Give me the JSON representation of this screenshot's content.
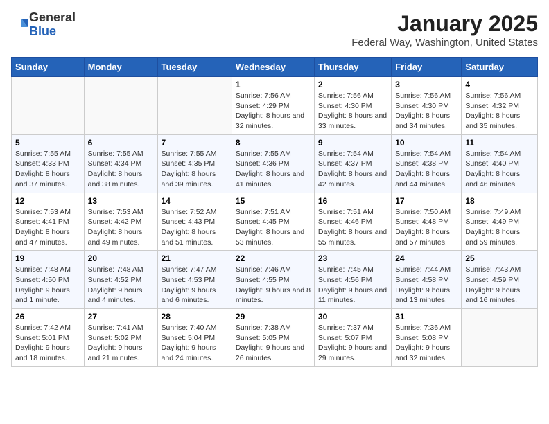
{
  "header": {
    "logo_general": "General",
    "logo_blue": "Blue",
    "title": "January 2025",
    "subtitle": "Federal Way, Washington, United States"
  },
  "days_of_week": [
    "Sunday",
    "Monday",
    "Tuesday",
    "Wednesday",
    "Thursday",
    "Friday",
    "Saturday"
  ],
  "weeks": [
    [
      {
        "num": "",
        "info": ""
      },
      {
        "num": "",
        "info": ""
      },
      {
        "num": "",
        "info": ""
      },
      {
        "num": "1",
        "info": "Sunrise: 7:56 AM\nSunset: 4:29 PM\nDaylight: 8 hours and 32 minutes."
      },
      {
        "num": "2",
        "info": "Sunrise: 7:56 AM\nSunset: 4:30 PM\nDaylight: 8 hours and 33 minutes."
      },
      {
        "num": "3",
        "info": "Sunrise: 7:56 AM\nSunset: 4:30 PM\nDaylight: 8 hours and 34 minutes."
      },
      {
        "num": "4",
        "info": "Sunrise: 7:56 AM\nSunset: 4:32 PM\nDaylight: 8 hours and 35 minutes."
      }
    ],
    [
      {
        "num": "5",
        "info": "Sunrise: 7:55 AM\nSunset: 4:33 PM\nDaylight: 8 hours and 37 minutes."
      },
      {
        "num": "6",
        "info": "Sunrise: 7:55 AM\nSunset: 4:34 PM\nDaylight: 8 hours and 38 minutes."
      },
      {
        "num": "7",
        "info": "Sunrise: 7:55 AM\nSunset: 4:35 PM\nDaylight: 8 hours and 39 minutes."
      },
      {
        "num": "8",
        "info": "Sunrise: 7:55 AM\nSunset: 4:36 PM\nDaylight: 8 hours and 41 minutes."
      },
      {
        "num": "9",
        "info": "Sunrise: 7:54 AM\nSunset: 4:37 PM\nDaylight: 8 hours and 42 minutes."
      },
      {
        "num": "10",
        "info": "Sunrise: 7:54 AM\nSunset: 4:38 PM\nDaylight: 8 hours and 44 minutes."
      },
      {
        "num": "11",
        "info": "Sunrise: 7:54 AM\nSunset: 4:40 PM\nDaylight: 8 hours and 46 minutes."
      }
    ],
    [
      {
        "num": "12",
        "info": "Sunrise: 7:53 AM\nSunset: 4:41 PM\nDaylight: 8 hours and 47 minutes."
      },
      {
        "num": "13",
        "info": "Sunrise: 7:53 AM\nSunset: 4:42 PM\nDaylight: 8 hours and 49 minutes."
      },
      {
        "num": "14",
        "info": "Sunrise: 7:52 AM\nSunset: 4:43 PM\nDaylight: 8 hours and 51 minutes."
      },
      {
        "num": "15",
        "info": "Sunrise: 7:51 AM\nSunset: 4:45 PM\nDaylight: 8 hours and 53 minutes."
      },
      {
        "num": "16",
        "info": "Sunrise: 7:51 AM\nSunset: 4:46 PM\nDaylight: 8 hours and 55 minutes."
      },
      {
        "num": "17",
        "info": "Sunrise: 7:50 AM\nSunset: 4:48 PM\nDaylight: 8 hours and 57 minutes."
      },
      {
        "num": "18",
        "info": "Sunrise: 7:49 AM\nSunset: 4:49 PM\nDaylight: 8 hours and 59 minutes."
      }
    ],
    [
      {
        "num": "19",
        "info": "Sunrise: 7:48 AM\nSunset: 4:50 PM\nDaylight: 9 hours and 1 minute."
      },
      {
        "num": "20",
        "info": "Sunrise: 7:48 AM\nSunset: 4:52 PM\nDaylight: 9 hours and 4 minutes."
      },
      {
        "num": "21",
        "info": "Sunrise: 7:47 AM\nSunset: 4:53 PM\nDaylight: 9 hours and 6 minutes."
      },
      {
        "num": "22",
        "info": "Sunrise: 7:46 AM\nSunset: 4:55 PM\nDaylight: 9 hours and 8 minutes."
      },
      {
        "num": "23",
        "info": "Sunrise: 7:45 AM\nSunset: 4:56 PM\nDaylight: 9 hours and 11 minutes."
      },
      {
        "num": "24",
        "info": "Sunrise: 7:44 AM\nSunset: 4:58 PM\nDaylight: 9 hours and 13 minutes."
      },
      {
        "num": "25",
        "info": "Sunrise: 7:43 AM\nSunset: 4:59 PM\nDaylight: 9 hours and 16 minutes."
      }
    ],
    [
      {
        "num": "26",
        "info": "Sunrise: 7:42 AM\nSunset: 5:01 PM\nDaylight: 9 hours and 18 minutes."
      },
      {
        "num": "27",
        "info": "Sunrise: 7:41 AM\nSunset: 5:02 PM\nDaylight: 9 hours and 21 minutes."
      },
      {
        "num": "28",
        "info": "Sunrise: 7:40 AM\nSunset: 5:04 PM\nDaylight: 9 hours and 24 minutes."
      },
      {
        "num": "29",
        "info": "Sunrise: 7:38 AM\nSunset: 5:05 PM\nDaylight: 9 hours and 26 minutes."
      },
      {
        "num": "30",
        "info": "Sunrise: 7:37 AM\nSunset: 5:07 PM\nDaylight: 9 hours and 29 minutes."
      },
      {
        "num": "31",
        "info": "Sunrise: 7:36 AM\nSunset: 5:08 PM\nDaylight: 9 hours and 32 minutes."
      },
      {
        "num": "",
        "info": ""
      }
    ]
  ]
}
